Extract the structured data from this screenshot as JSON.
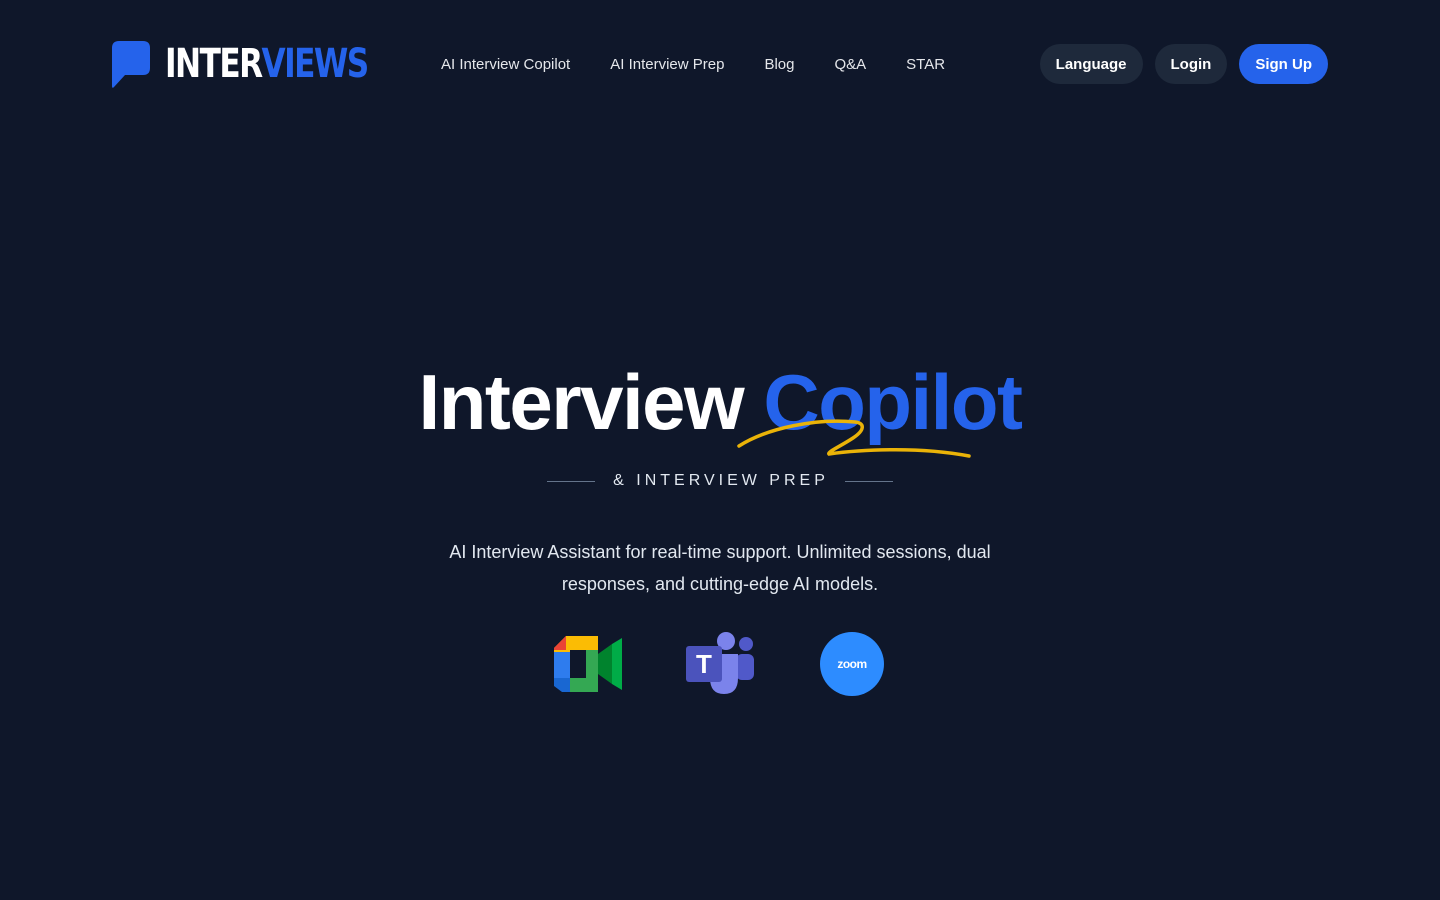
{
  "brand": {
    "name_part1": "INTER",
    "name_part2": "VIEWS",
    "accent_color": "#2563eb",
    "background_color": "#0f172a"
  },
  "nav": {
    "items": [
      {
        "label": "AI Interview Copilot"
      },
      {
        "label": "AI Interview Prep"
      },
      {
        "label": "Blog"
      },
      {
        "label": "Q&A"
      },
      {
        "label": "STAR"
      }
    ]
  },
  "actions": {
    "language_label": "Language",
    "login_label": "Login",
    "signup_label": "Sign Up"
  },
  "hero": {
    "title_main": "Interview",
    "title_accent": "Copilot",
    "subtitle": "& INTERVIEW PREP",
    "description": "AI Interview Assistant for real-time support. Unlimited sessions, dual responses, and cutting-edge AI models.",
    "squiggle_color": "#eab308"
  },
  "platforms": [
    {
      "icon": "google-meet-icon"
    },
    {
      "icon": "microsoft-teams-icon"
    },
    {
      "icon": "zoom-icon",
      "label": "zoom"
    }
  ]
}
